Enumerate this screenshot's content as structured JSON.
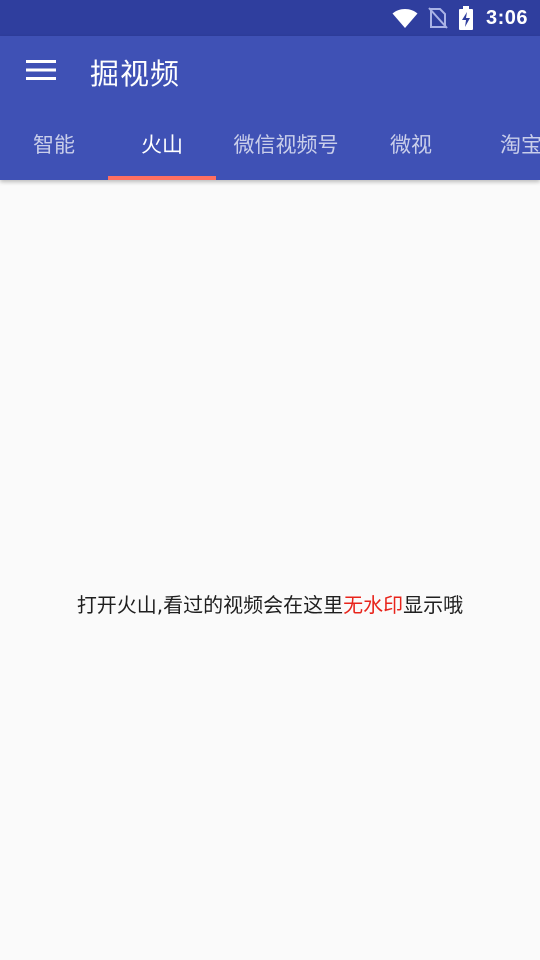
{
  "status_bar": {
    "time": "3:06",
    "icons": [
      "wifi-icon",
      "no-sim-icon",
      "battery-charging-icon"
    ]
  },
  "toolbar": {
    "menu_icon": "hamburger-menu-icon",
    "title": "掘视频"
  },
  "tabs": [
    {
      "label": "智能",
      "active": false
    },
    {
      "label": "火山",
      "active": true
    },
    {
      "label": "微信视频号",
      "active": false
    },
    {
      "label": "微视",
      "active": false
    },
    {
      "label": "淘宝",
      "active": false
    }
  ],
  "content": {
    "message_before": "打开火山,看过的视频会在这里",
    "message_highlight": "无水印",
    "message_after": "显示哦",
    "highlight_color": "#e8241b"
  },
  "colors": {
    "status_bar": "#2f3e9e",
    "app_bar": "#3f51b5",
    "tab_indicator": "#ff6f61",
    "background": "#fafafa"
  }
}
